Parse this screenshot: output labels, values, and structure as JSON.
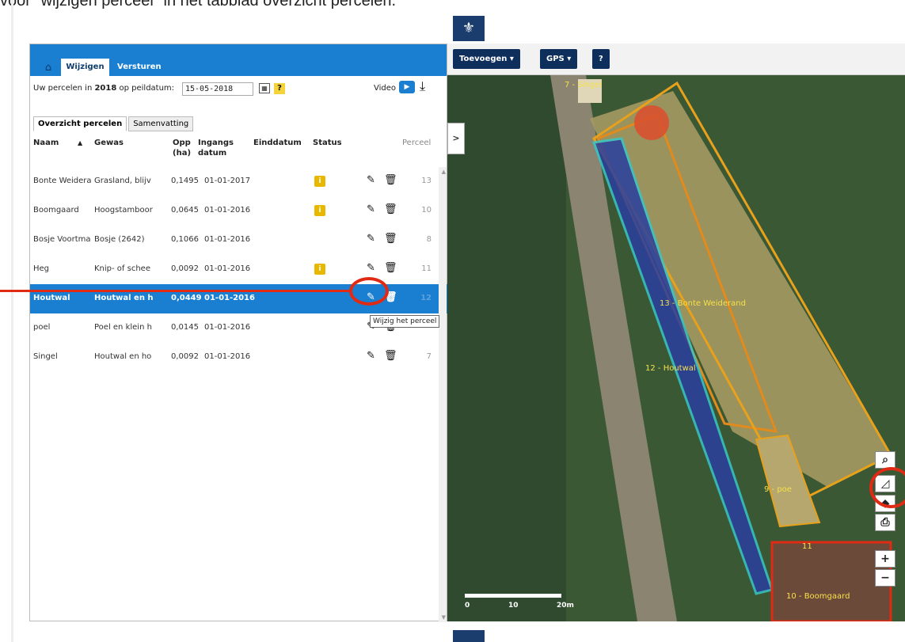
{
  "doc": {
    "text": "voor \"wijzigen perceel\" in het tabblad overzicht percelen."
  },
  "topbar": {
    "tab_active": "Wijzigen",
    "tab_send": "Versturen"
  },
  "datebar": {
    "label_pre": "Uw percelen in ",
    "year": "2018",
    "label_post": " op peildatum:",
    "date_value": "15-05-2018",
    "help": "?",
    "video": "Video"
  },
  "tabs": [
    "Overzicht percelen",
    "Samenvatting"
  ],
  "table": {
    "headers": {
      "naam": "Naam",
      "gewas": "Gewas",
      "opp": "Opp",
      "opp_unit": "(ha)",
      "ingang": "Ingangs",
      "ingang2": "datum",
      "eind": "Einddatum",
      "status": "Status",
      "perceel": "Perceel"
    },
    "rows": [
      {
        "naam": "Bonte Weidera",
        "gewas": "Grasland, blijv",
        "opp": "0,1495",
        "ingang": "01-01-2017",
        "status": "i",
        "perceel": "13"
      },
      {
        "naam": "Boomgaard",
        "gewas": "Hoogstamboor",
        "opp": "0,0645",
        "ingang": "01-01-2016",
        "status": "i",
        "perceel": "10"
      },
      {
        "naam": "Bosje Voortma",
        "gewas": "Bosje (2642)",
        "opp": "0,1066",
        "ingang": "01-01-2016",
        "status": "",
        "perceel": "8"
      },
      {
        "naam": "Heg",
        "gewas": "Knip- of schee",
        "opp": "0,0092",
        "ingang": "01-01-2016",
        "status": "i",
        "perceel": "11"
      },
      {
        "naam": "Houtwal",
        "gewas": "Houtwal en h",
        "opp": "0,0449",
        "ingang": "01-01-2016",
        "status": "",
        "perceel": "12"
      },
      {
        "naam": "poel",
        "gewas": "Poel en klein h",
        "opp": "0,0145",
        "ingang": "01-01-2016",
        "status": "",
        "perceel": ""
      },
      {
        "naam": "Singel",
        "gewas": "Houtwal en ho",
        "opp": "0,0092",
        "ingang": "01-01-2016",
        "status": "",
        "perceel": "7"
      }
    ]
  },
  "tooltip": "Wijzig het perceel",
  "map": {
    "buttons": {
      "toevoegen": "Toevoegen",
      "gps": "GPS",
      "help": "?"
    },
    "collapse": ">",
    "labels": {
      "singel": "7 - Singel",
      "bonte": "13 - Bonte Weiderand",
      "houtwal": "12 - Houtwal",
      "poel": "9 - poe",
      "heg": "11",
      "boomgaard": "10 - Boomgaard"
    },
    "scale": {
      "zero": "0",
      "ten": "10",
      "twenty": "20m"
    },
    "controls": {
      "zoom_in": "+",
      "zoom_out": "−"
    }
  },
  "colors": {
    "accent": "#1a7fd0",
    "navy": "#0e2e5c",
    "highlight": "#e02a14",
    "status": "#e8b800"
  }
}
